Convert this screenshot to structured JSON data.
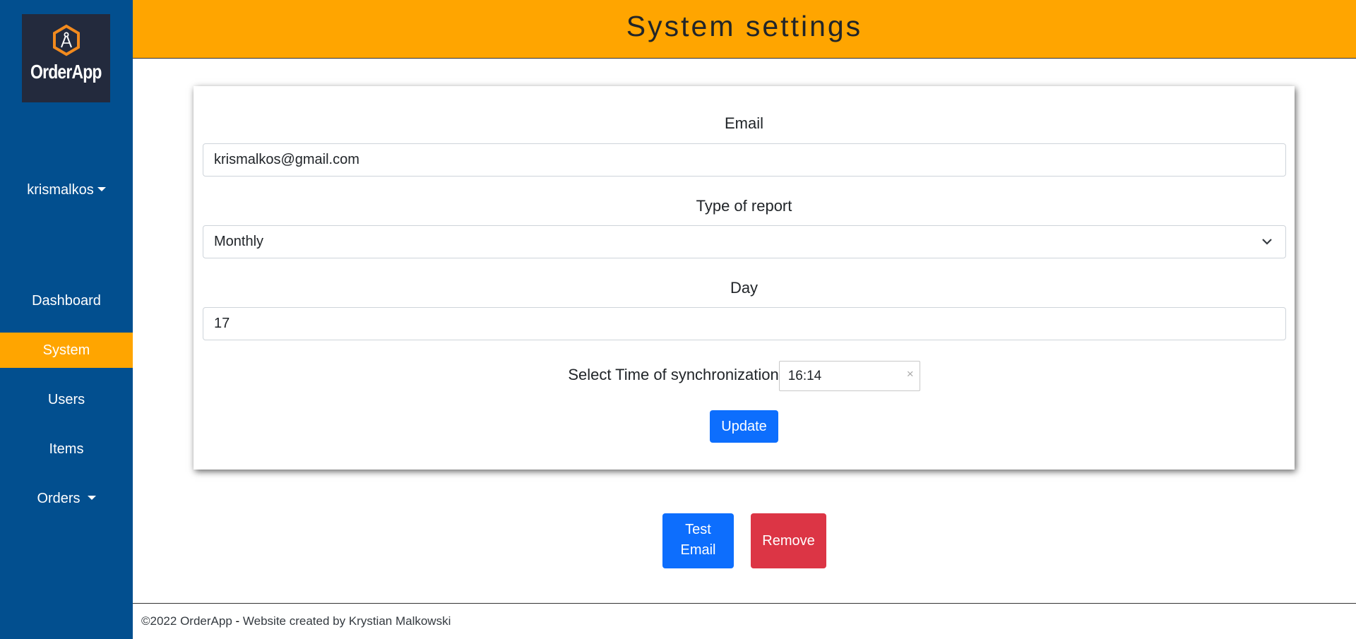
{
  "app": {
    "logo_text": "OrderApp"
  },
  "header": {
    "title": "System settings"
  },
  "sidebar": {
    "user": "krismalkos",
    "items": [
      {
        "label": "Dashboard"
      },
      {
        "label": "System"
      },
      {
        "label": "Users"
      },
      {
        "label": "Items"
      },
      {
        "label": "Orders"
      }
    ]
  },
  "form": {
    "email_label": "Email",
    "email_value": "krismalkos@gmail.com",
    "report_label": "Type of report",
    "report_value": "Monthly",
    "day_label": "Day",
    "day_value": "17",
    "time_label": "Select Time of synchronization",
    "time_value": "16:14",
    "clear_symbol": "×",
    "update_label": "Update"
  },
  "actions": {
    "test_email_line1": "Test",
    "test_email_line2": "Email",
    "remove_label": "Remove"
  },
  "footer": {
    "copyright": "©2022 OrderApp",
    "separator": " - ",
    "credit": "Website created by Krystian Malkowski"
  },
  "colors": {
    "sidebar": "#024f8f",
    "accent": "#ffa500",
    "primary": "#0d6efd",
    "danger": "#dc3545",
    "logo_bg": "#232a3d"
  },
  "icons": {
    "logo": "compass-hexagon-icon",
    "user_caret": "caret-down-icon",
    "select": "chevron-down-icon",
    "clear": "close-icon"
  }
}
